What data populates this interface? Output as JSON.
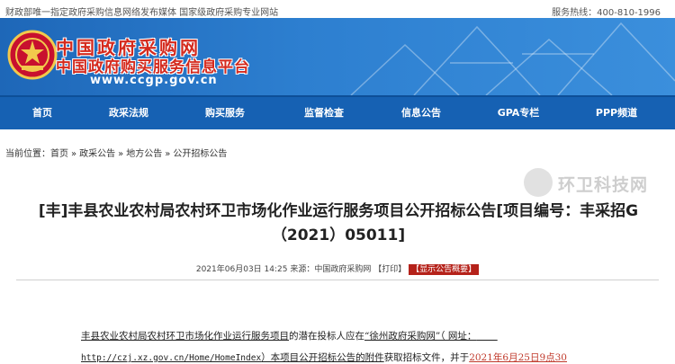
{
  "topbar": {
    "left_text": "财政部唯一指定政府采购信息网络发布媒体 国家级政府采购专业网站",
    "hotline": "服务热线：400-810-1996"
  },
  "banner": {
    "title_cn": "中国政府采购网",
    "subtitle_cn": "中国政府购买服务信息平台",
    "url": "www.ccgp.gov.cn"
  },
  "nav": {
    "items": [
      "首页",
      "政采法规",
      "购买服务",
      "监督检查",
      "信息公告",
      "GPA专栏",
      "PPP频道"
    ]
  },
  "breadcrumb": {
    "label": "当前位置：",
    "items": [
      "首页",
      "政采公告",
      "地方公告",
      "公开招标公告"
    ],
    "separator": "»"
  },
  "watermark": {
    "text": "环卫科技网"
  },
  "article": {
    "title": "[丰]丰县农业农村局农村环卫市场化作业运行服务项目公开招标公告[项目编号：丰采招G（2021）05011]",
    "date": "2021年06月03日 14:25",
    "source": "来源：中国政府采购网",
    "print_label": "【打印】",
    "toggle_label": "【显示公告概要】",
    "para1": {
      "a": "丰县农业农村局农村环卫市场化作业运行服务项目",
      "b": "的潜在投标人应在",
      "c": "“徐州政府采购网”（ 网址：",
      "d": "       "
    },
    "para2": {
      "a": "http://czj.xz.gov.cn/Home/HomeIndex",
      "b": "）本项目公开招标公告的附件",
      "c": "获取招标文件，并于",
      "d": "2021年6月25日9点30"
    }
  },
  "colors": {
    "nav_bg": "#1661b3",
    "banner": "#2d7fd0",
    "accent_red": "#c0392b"
  }
}
